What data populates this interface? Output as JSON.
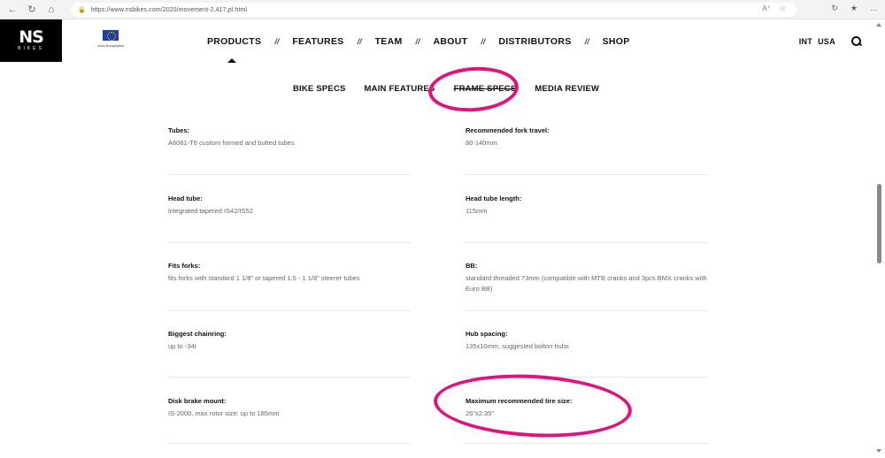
{
  "browser": {
    "url": "https://www.nsbikes.com/2020/movement-2,417,pl.html",
    "back_icon": "arrow-left",
    "refresh_icon": "refresh",
    "home_icon": "home",
    "actions": [
      "Aᴬ",
      "☆",
      "↻",
      "☆≡",
      "…"
    ]
  },
  "site": {
    "logo_main": "NS",
    "logo_sub": "BIKES",
    "eu_label": "Unia Europejska",
    "nav": [
      "PRODUCTS",
      "FEATURES",
      "TEAM",
      "ABOUT",
      "DISTRIBUTORS",
      "SHOP"
    ],
    "nav_separator": "//",
    "region_int": "INT",
    "region_usa": "USA"
  },
  "tabs": {
    "bike_specs": "BIKE SPECS",
    "main_features": "MAIN FEATURES",
    "frame_specs": "FRAME SPECS",
    "media_review": "MEDIA REVIEW"
  },
  "specs": [
    {
      "label": "Tubes:",
      "value": "A6061-T6 custom formed and butted tubes"
    },
    {
      "label": "Recommended fork travel:",
      "value": "80-140mm"
    },
    {
      "label": "Head tube:",
      "value": "integrated tapered IS42/IS52"
    },
    {
      "label": "Head tube length:",
      "value": "115mm"
    },
    {
      "label": "Fits forks:",
      "value": "fits forks with standard 1 1/8\" or tapered 1.5 - 1 1/8\" steerer tubes"
    },
    {
      "label": "BB:",
      "value": "standard threaded 73mm (compatible with MTB cranks and 3pcs BMX cranks with Euro BB)"
    },
    {
      "label": "Biggest chainring:",
      "value": "up to -34t"
    },
    {
      "label": "Hub spacing:",
      "value": "135x10mm, suggested bolton hubs"
    },
    {
      "label": "Disk brake mount:",
      "value": "IS-2000, max rotor size: up to 185mm"
    },
    {
      "label": "Maximum recommended tire size:",
      "value": "26\"x2.35\""
    }
  ],
  "colors": {
    "annotation": "#e0127e",
    "logo_bg": "#000000"
  }
}
